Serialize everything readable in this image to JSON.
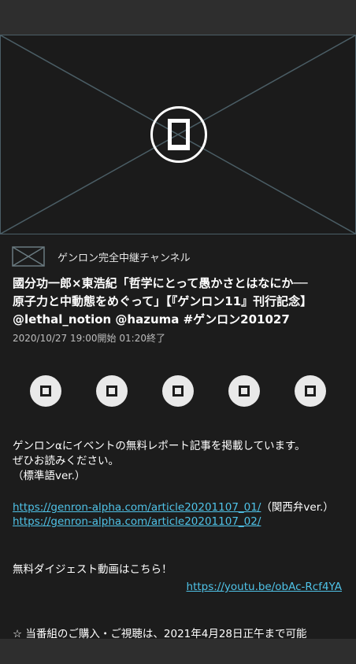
{
  "channel": {
    "name": "ゲンロン完全中継チャンネル"
  },
  "program": {
    "title_line1": "國分功一郎×東浩紀「哲学にとって愚かさとはなにか──",
    "title_line2": "原子力と中動態をめぐって」【『ゲンロン11』刊行記念】",
    "title_line3": "@lethal_notion @hazuma #ゲンロン201027",
    "datetime": "2020/10/27 19:00開始 01:20終了"
  },
  "actions": [
    {
      "icon": "action-icon-1"
    },
    {
      "icon": "action-icon-2"
    },
    {
      "icon": "action-icon-3"
    },
    {
      "icon": "action-icon-4"
    },
    {
      "icon": "action-icon-5"
    }
  ],
  "description": {
    "line1": "ゲンロンαにイベントの無料レポート記事を掲載しています。",
    "line2": "ぜひお読みください。",
    "line3": "（標準語ver.）",
    "link1": "https://genron-alpha.com/article20201107_01/",
    "link1_suffix": "（関西弁ver.）",
    "link2": "https://genron-alpha.com/article20201107_02/",
    "digest_text": "無料ダイジェスト動画はこちら！",
    "digest_link": "https://youtu.be/obAc-Rcf4YA",
    "notice": "☆ 当番組のご購入・ご視聴は、2021年4月28日正午まで可能"
  },
  "colors": {
    "background": "#1c1c1c",
    "bar": "#2e2e2e",
    "link": "#4fc3e8",
    "placeholder_border": "#4b5e66"
  }
}
